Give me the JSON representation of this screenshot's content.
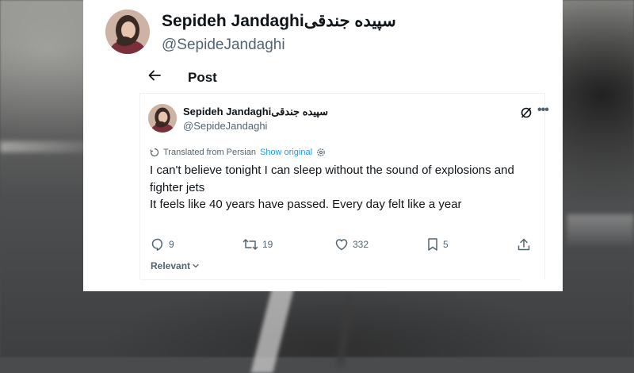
{
  "header_profile": {
    "display_name": "Sepideh Jandaghiسپیده جندقی",
    "handle": "@SepideJandaghi"
  },
  "post_header": {
    "title": "Post"
  },
  "tweet": {
    "author_name": "Sepideh Jandaghiسپیده جندقی",
    "author_handle": "@SepideJandaghi",
    "translated_label": "Translated from Persian",
    "show_original_label": "Show original",
    "text_lines": [
      "I can't believe tonight I can sleep without the sound of explosions and",
      "fighter jets",
      "It feels like 40 years have passed. Every day felt like a year"
    ]
  },
  "actions": {
    "replies": "9",
    "reposts": "19",
    "likes": "332",
    "bookmarks": "5"
  },
  "sort": {
    "label": "Relevant"
  },
  "icons": {
    "back": "back-arrow-icon",
    "grok": "grok-icon",
    "more": "more-icon",
    "translate": "translate-icon",
    "settings": "settings-icon",
    "reply": "reply-icon",
    "repost": "repost-icon",
    "like": "like-icon",
    "bookmark": "bookmark-icon",
    "share": "share-icon",
    "chevron": "chevron-down-icon"
  },
  "colors": {
    "text": "#0f1419",
    "secondary": "#536471",
    "link": "#1d9bf0"
  }
}
